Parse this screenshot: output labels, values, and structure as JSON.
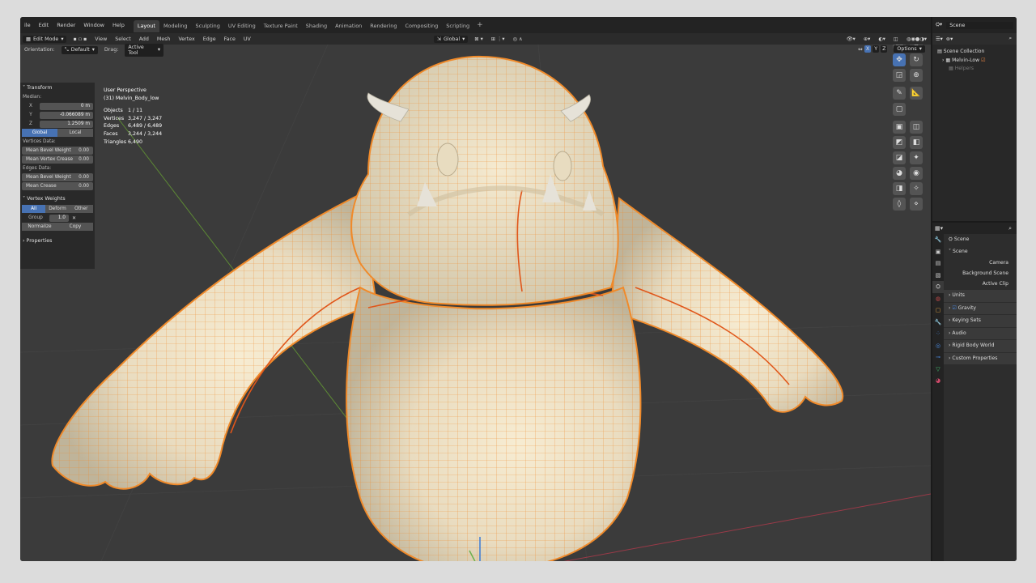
{
  "menubar": {
    "items": [
      "ile",
      "Edit",
      "Render",
      "Window",
      "Help"
    ],
    "workspaces": [
      "Layout",
      "Modeling",
      "Sculpting",
      "UV Editing",
      "Texture Paint",
      "Shading",
      "Animation",
      "Rendering",
      "Compositing",
      "Scripting"
    ],
    "active_workspace": "Layout",
    "add_tab": "+"
  },
  "viewport_header": {
    "mode": "Edit Mode",
    "menus": [
      "View",
      "Select",
      "Add",
      "Mesh",
      "Vertex",
      "Edge",
      "Face",
      "UV"
    ],
    "transform_orientation": "Global",
    "options": "Options",
    "axes": [
      "X",
      "Y",
      "Z"
    ]
  },
  "tool_settings": {
    "orientation_label": "Orientation:",
    "orientation_value": "Default",
    "drag_label": "Drag:",
    "drag_value": "Active Tool"
  },
  "npanel": {
    "transform_title": "Transform",
    "median_label": "Median:",
    "x_label": "X",
    "x_value": "0 m",
    "y_label": "Y",
    "y_value": "-0.066089 m",
    "z_label": "Z",
    "z_value": "1.2509 m",
    "global_btn": "Global",
    "local_btn": "Local",
    "vertices_data_label": "Vertices Data:",
    "mean_bevel_weight_label": "Mean Bevel Weight",
    "mean_bevel_weight_value": "0.00",
    "mean_vertex_crease_label": "Mean Vertex Crease",
    "mean_vertex_crease_value": "0.00",
    "edges_data_label": "Edges Data:",
    "edge_bevel_weight_label": "Mean Bevel Weight",
    "edge_bevel_weight_value": "0.00",
    "mean_crease_label": "Mean Crease",
    "mean_crease_value": "0.00",
    "vertex_weights_title": "Vertex Weights",
    "vw_all": "All",
    "vw_deform": "Deform",
    "vw_other": "Other",
    "group_label": "Group",
    "group_value": "1.0",
    "normalize_btn": "Normalize",
    "copy_btn": "Copy",
    "properties_title": "Properties"
  },
  "overlay": {
    "view_name": "User Perspective",
    "object_name": "(31) Melvin_Body_low",
    "stats": [
      {
        "k": "Objects",
        "v": "1 / 11"
      },
      {
        "k": "Vertices",
        "v": "3,247 / 3,247"
      },
      {
        "k": "Edges",
        "v": "6,489 / 6,489"
      },
      {
        "k": "Faces",
        "v": "3,244 / 3,244"
      },
      {
        "k": "Triangles",
        "v": "6,490"
      }
    ]
  },
  "outliner": {
    "scene_name": "Scene",
    "items": [
      "Scene Collection",
      "Melvin-Low",
      "Helpers"
    ]
  },
  "properties": {
    "scene_title": "Scene",
    "scene_panel": "Scene",
    "camera_label": "Camera",
    "background_scene_label": "Background Scene",
    "active_clip_label": "Active Clip",
    "units": "Units",
    "gravity": "Gravity",
    "keying_sets": "Keying Sets",
    "audio": "Audio",
    "rigid_body_world": "Rigid Body World",
    "custom_properties": "Custom Properties"
  },
  "colors": {
    "accent": "#4772b3",
    "mesh_fill": "#e9dcc0",
    "wire": "#f08a2a",
    "seam": "#e0561a",
    "grid_x": "#9a3a48",
    "grid_y": "#5d8a35"
  }
}
